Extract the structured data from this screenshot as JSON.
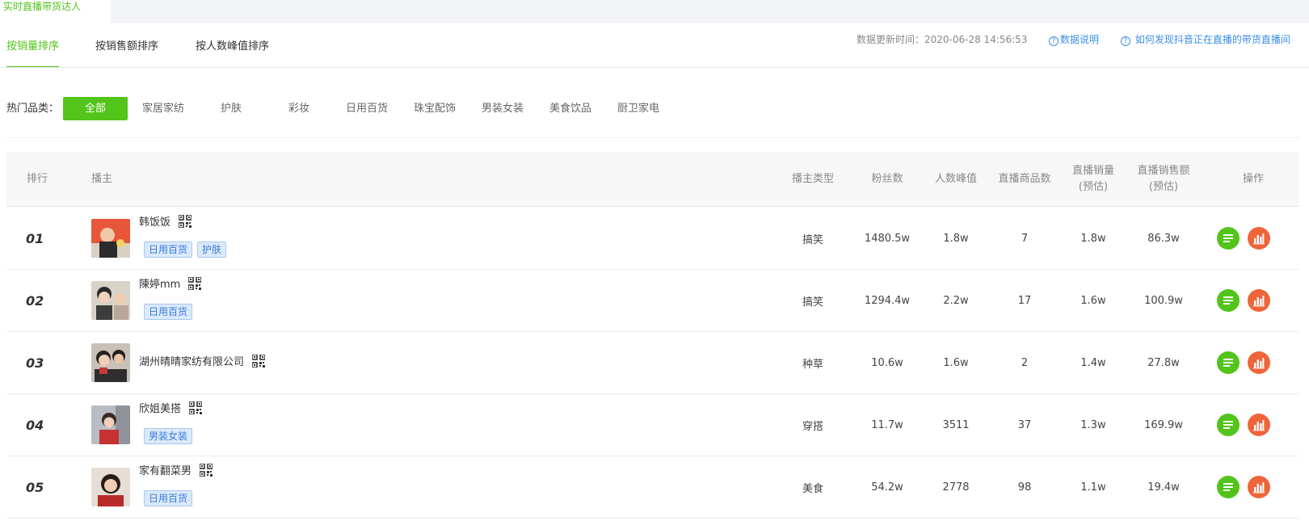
{
  "top_tab": "实时直播带货达人",
  "sort_tabs": [
    {
      "label": "按销量排序",
      "active": true
    },
    {
      "label": "按销售额排序",
      "active": false
    },
    {
      "label": "按人数峰值排序",
      "active": false
    }
  ],
  "update_time": "数据更新时间：2020-06-28 14:56:53",
  "links": {
    "data_explain": "数据说明",
    "how_to_find": "如何发现抖音正在直播的带货直播间"
  },
  "categories": {
    "label": "热门品类：",
    "items": [
      "全部",
      "家居家纺",
      "护肤",
      "彩妆",
      "日用百货",
      "珠宝配饰",
      "男装女装",
      "美食饮品",
      "厨卫家电"
    ],
    "active_index": 0
  },
  "table": {
    "headers": {
      "rank": "排行",
      "anchor": "播主",
      "anchor_type": "播主类型",
      "fans": "粉丝数",
      "peak": "人数峰值",
      "goods_count": "直播商品数",
      "sales_volume_line1": "直播销量",
      "sales_volume_line2": "(预估)",
      "sales_amount_line1": "直播销售额",
      "sales_amount_line2": "(预估)",
      "ops": "操作"
    },
    "rows": [
      {
        "rank": "01",
        "name": "韩饭饭",
        "tags": [
          "日用百货",
          "护肤"
        ],
        "type": "搞笑",
        "fans": "1480.5w",
        "peak": "1.8w",
        "goods": "7",
        "volume": "1.8w",
        "amount": "86.3w"
      },
      {
        "rank": "02",
        "name": "陳婷mm",
        "tags": [
          "日用百货"
        ],
        "type": "搞笑",
        "fans": "1294.4w",
        "peak": "2.2w",
        "goods": "17",
        "volume": "1.6w",
        "amount": "100.9w"
      },
      {
        "rank": "03",
        "name": "湖州晴晴家纺有限公司",
        "tags": [],
        "type": "种草",
        "fans": "10.6w",
        "peak": "1.6w",
        "goods": "2",
        "volume": "1.4w",
        "amount": "27.8w"
      },
      {
        "rank": "04",
        "name": "欣姐美搭",
        "tags": [
          "男装女装"
        ],
        "type": "穿搭",
        "fans": "11.7w",
        "peak": "3511",
        "goods": "37",
        "volume": "1.3w",
        "amount": "169.9w"
      },
      {
        "rank": "05",
        "name": "家有翻菜男",
        "tags": [
          "日用百货"
        ],
        "type": "美食",
        "fans": "54.2w",
        "peak": "2778",
        "goods": "98",
        "volume": "1.1w",
        "amount": "19.4w"
      }
    ]
  },
  "colors": {
    "accent_green": "#52c41a",
    "link_blue": "#3a8ee6",
    "op_red": "#f0643a",
    "tag_bg": "#dbe9fb"
  },
  "icons": {
    "qr": "qr-code-icon",
    "detail": "list-detail-icon",
    "stats": "bar-chart-icon"
  }
}
